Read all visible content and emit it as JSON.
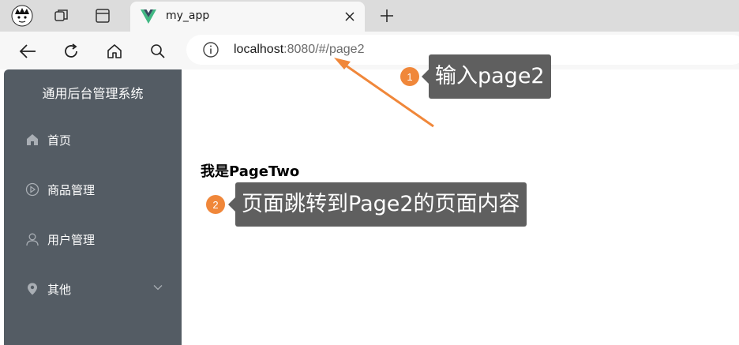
{
  "browser": {
    "tab_title": "my_app",
    "url_host": "localhost",
    "url_rest": ":8080/#/page2"
  },
  "sidebar": {
    "title": "通用后台管理系统",
    "items": [
      {
        "label": "首页",
        "icon": "home-icon"
      },
      {
        "label": "商品管理",
        "icon": "play-circle-icon"
      },
      {
        "label": "用户管理",
        "icon": "user-icon"
      },
      {
        "label": "其他",
        "icon": "location-icon"
      }
    ]
  },
  "main": {
    "heading": "我是PageTwo"
  },
  "annotations": [
    {
      "number": "1",
      "text": "输入page2"
    },
    {
      "number": "2",
      "text": "页面跳转到Page2的页面内容"
    }
  ],
  "colors": {
    "sidebar_bg": "#545c64",
    "accent_orange": "#f0873a",
    "callout_bg": "#5f5f5f",
    "vue_green": "#41b883"
  }
}
